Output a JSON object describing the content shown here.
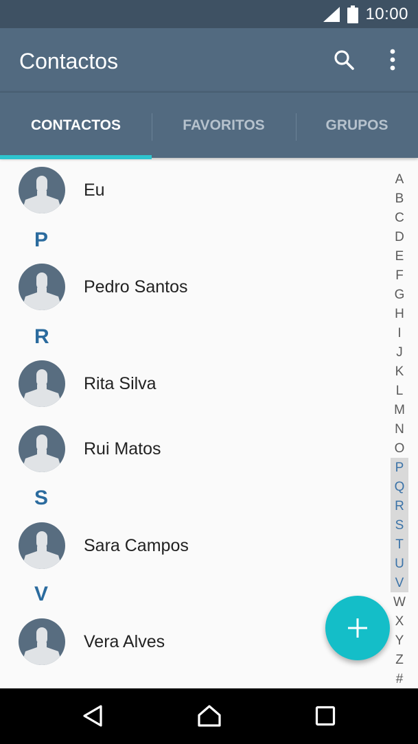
{
  "status_bar": {
    "time": "10:00",
    "icons": [
      "signal-icon",
      "battery-icon"
    ]
  },
  "app_bar": {
    "title": "Contactos",
    "icons": [
      "search-icon",
      "more-vert-icon"
    ]
  },
  "tabs": [
    {
      "label": "CONTACTOS",
      "selected": true
    },
    {
      "label": "FAVORITOS",
      "selected": false
    },
    {
      "label": "GRUPOS",
      "selected": false
    }
  ],
  "contacts": {
    "eu": "Eu",
    "header_p": "P",
    "pedro": "Pedro Santos",
    "header_r": "R",
    "rita": "Rita Silva",
    "rui": "Rui Matos",
    "header_s": "S",
    "sara": "Sara Campos",
    "header_v": "V",
    "vera": "Vera Alves"
  },
  "alphabet_index": [
    "A",
    "B",
    "C",
    "D",
    "E",
    "F",
    "G",
    "H",
    "I",
    "J",
    "K",
    "L",
    "M",
    "N",
    "O",
    "P",
    "Q",
    "R",
    "S",
    "T",
    "U",
    "V",
    "W",
    "X",
    "Y",
    "Z",
    "#"
  ],
  "alphabet_highlighted": [
    "P",
    "Q",
    "R",
    "S",
    "T",
    "U",
    "V"
  ],
  "fab": {
    "icon": "add-icon"
  },
  "nav_bar": {
    "icons": [
      "back-icon",
      "home-icon",
      "recents-icon"
    ]
  },
  "colors": {
    "status_bar": "#3e5163",
    "app_bar": "#526a80",
    "accent": "#2ec4cf",
    "fab": "#14bec8",
    "section_header": "#2b6b9e"
  }
}
